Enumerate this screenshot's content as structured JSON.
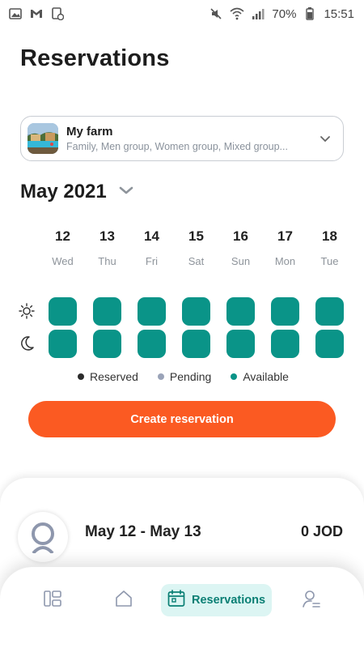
{
  "status_bar": {
    "battery": "70%",
    "time": "15:51"
  },
  "page": {
    "title": "Reservations"
  },
  "farm_selector": {
    "name": "My farm",
    "groups": "Family, Men group, Women group, Mixed group..."
  },
  "calendar": {
    "month": "May 2021",
    "days": [
      {
        "num": "12",
        "name": "Wed"
      },
      {
        "num": "13",
        "name": "Thu"
      },
      {
        "num": "14",
        "name": "Fri"
      },
      {
        "num": "15",
        "name": "Sat"
      },
      {
        "num": "16",
        "name": "Sun"
      },
      {
        "num": "17",
        "name": "Mon"
      },
      {
        "num": "18",
        "name": "Tue"
      }
    ],
    "morning_slots": [
      "available",
      "available",
      "available",
      "available",
      "available",
      "available",
      "available"
    ],
    "night_slots": [
      "available",
      "available",
      "available",
      "available",
      "available",
      "available",
      "available"
    ]
  },
  "legend": {
    "reserved": "Reserved",
    "pending": "Pending",
    "available": "Available"
  },
  "colors": {
    "available": "#0a9488",
    "reserved": "#2b2b2b",
    "pending": "#9aa3b8",
    "accent": "#fb5a22",
    "nav_active_bg": "#dcf5f3"
  },
  "actions": {
    "create_label": "Create reservation"
  },
  "reservation_list": [
    {
      "dates": "May 12 - May 13",
      "price": "0 JOD"
    }
  ],
  "bottom_nav": {
    "active_label": "Reservations"
  }
}
